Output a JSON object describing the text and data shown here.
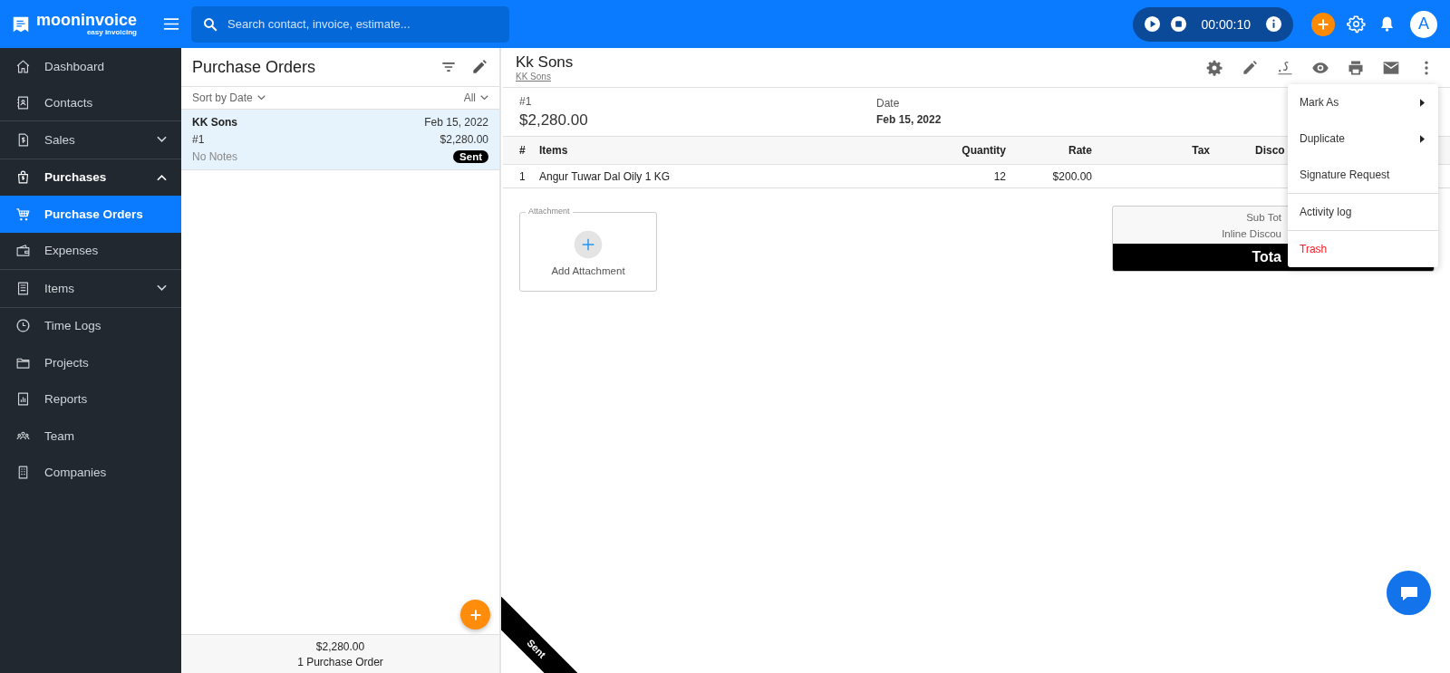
{
  "brand": {
    "name": "mooninvoice",
    "tagline": "easy invoicing"
  },
  "search": {
    "placeholder": "Search contact, invoice, estimate..."
  },
  "timer": {
    "elapsed": "00:00:10"
  },
  "avatar": {
    "initial": "A"
  },
  "sidebar": {
    "items": [
      {
        "label": "Dashboard",
        "selected": false
      },
      {
        "label": "Contacts",
        "selected": false
      },
      {
        "label": "Sales",
        "selected": false,
        "expanded": false
      },
      {
        "label": "Purchases",
        "selected": false,
        "expanded": true,
        "children": [
          {
            "label": "Purchase Orders",
            "selected": true
          },
          {
            "label": "Expenses",
            "selected": false
          }
        ]
      },
      {
        "label": "Items",
        "selected": false,
        "expanded": false
      },
      {
        "label": "Time Logs",
        "selected": false
      },
      {
        "label": "Projects",
        "selected": false
      },
      {
        "label": "Reports",
        "selected": false
      },
      {
        "label": "Team",
        "selected": false
      },
      {
        "label": "Companies",
        "selected": false
      }
    ]
  },
  "list_panel": {
    "title": "Purchase Orders",
    "sort": "Sort by Date",
    "filter": "All",
    "orders": [
      {
        "vendor": "KK Sons",
        "date": "Feb 15, 2022",
        "number": "#1",
        "amount": "$2,280.00",
        "notes": "No Notes",
        "status": "Sent",
        "selected": true
      }
    ],
    "footer": {
      "total": "$2,280.00",
      "count": "1 Purchase Order"
    }
  },
  "detail": {
    "title": "Kk Sons",
    "contact_link": "KK Sons",
    "number": "#1",
    "amount": "$2,280.00",
    "date_label": "Date",
    "date": "Feb 15, 2022",
    "columns": [
      "#",
      "Items",
      "Quantity",
      "Rate",
      "Tax",
      "Disco"
    ],
    "rows": [
      [
        "1",
        "Angur Tuwar Dal Oily 1 KG",
        "12",
        "$200.00"
      ]
    ],
    "attachment": {
      "legend": "Attachment",
      "button": "Add Attachment"
    },
    "totals": {
      "labels": [
        "Sub Tot",
        "Inline Discou"
      ],
      "total_label": "Tota"
    },
    "status_ribbon": "Sent"
  },
  "menu": {
    "items": [
      {
        "label": "Mark As",
        "submenu": true,
        "destructive": false,
        "divider_before": false
      },
      {
        "label": "Duplicate",
        "submenu": true,
        "destructive": false,
        "divider_before": false
      },
      {
        "label": "Signature Request",
        "submenu": false,
        "destructive": false,
        "divider_before": false
      },
      {
        "label": "Activity log",
        "submenu": false,
        "destructive": false,
        "divider_before": true
      },
      {
        "label": "Trash",
        "submenu": false,
        "destructive": true,
        "divider_before": true
      }
    ]
  }
}
